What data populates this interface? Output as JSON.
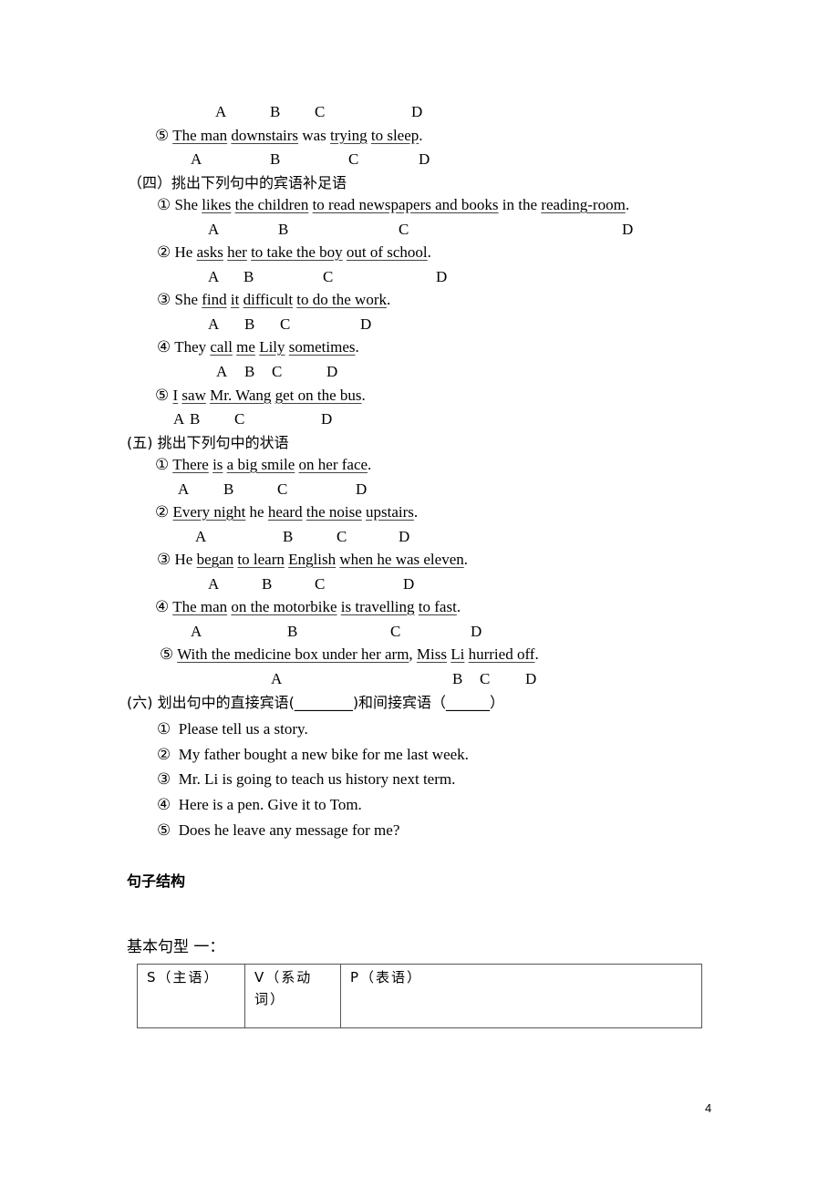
{
  "top_labels": [
    "A",
    "B",
    "C",
    "D"
  ],
  "section3_item5": {
    "num": "⑤",
    "parts": [
      {
        "text": "The man",
        "u": true
      },
      {
        "text": " ",
        "u": false
      },
      {
        "text": "downstairs",
        "u": true
      },
      {
        "text": " was ",
        "u": false
      },
      {
        "text": "trying",
        "u": true
      },
      {
        "text": " ",
        "u": false
      },
      {
        "text": "to sleep",
        "u": true
      },
      {
        "text": ".",
        "u": false
      }
    ],
    "labels": [
      "A",
      "B",
      "C",
      "D"
    ]
  },
  "section4": {
    "title": "（四）挑出下列句中的宾语补足语",
    "items": [
      {
        "num": "①",
        "parts": [
          {
            "text": "She ",
            "u": false
          },
          {
            "text": "likes",
            "u": true
          },
          {
            "text": " ",
            "u": false
          },
          {
            "text": "the children",
            "u": true
          },
          {
            "text": " ",
            "u": false
          },
          {
            "text": "to read newspapers and books",
            "u": true
          },
          {
            "text": " in the ",
            "u": false
          },
          {
            "text": "reading-room",
            "u": true
          },
          {
            "text": ".",
            "u": false
          }
        ],
        "labels": [
          "A",
          "B",
          "C",
          "D"
        ]
      },
      {
        "num": "②",
        "parts": [
          {
            "text": "He ",
            "u": false
          },
          {
            "text": "asks",
            "u": true
          },
          {
            "text": " ",
            "u": false
          },
          {
            "text": "her",
            "u": true
          },
          {
            "text": " ",
            "u": false
          },
          {
            "text": "to take the boy",
            "u": true
          },
          {
            "text": " ",
            "u": false
          },
          {
            "text": "out of school",
            "u": true
          },
          {
            "text": ".",
            "u": false
          }
        ],
        "labels": [
          "A",
          "B",
          "C",
          "D"
        ]
      },
      {
        "num": "③",
        "parts": [
          {
            "text": "She ",
            "u": false
          },
          {
            "text": "find",
            "u": true
          },
          {
            "text": " ",
            "u": false
          },
          {
            "text": "it",
            "u": true
          },
          {
            "text": " ",
            "u": false
          },
          {
            "text": "difficult",
            "u": true
          },
          {
            "text": " ",
            "u": false
          },
          {
            "text": "to do the work",
            "u": true
          },
          {
            "text": ".",
            "u": false
          }
        ],
        "labels": [
          "A",
          "B",
          "C",
          "D"
        ]
      },
      {
        "num": "④",
        "parts": [
          {
            "text": "They ",
            "u": false
          },
          {
            "text": "call",
            "u": true
          },
          {
            "text": " ",
            "u": false
          },
          {
            "text": "me",
            "u": true
          },
          {
            "text": " ",
            "u": false
          },
          {
            "text": "Lily",
            "u": true
          },
          {
            "text": " ",
            "u": false
          },
          {
            "text": "sometimes",
            "u": true
          },
          {
            "text": ".",
            "u": false
          }
        ],
        "labels": [
          "A",
          "B",
          "C",
          "D"
        ]
      },
      {
        "num": "⑤",
        "parts": [
          {
            "text": "I",
            "u": true
          },
          {
            "text": " ",
            "u": false
          },
          {
            "text": "saw",
            "u": true
          },
          {
            "text": " ",
            "u": false
          },
          {
            "text": "Mr. Wang",
            "u": true
          },
          {
            "text": " ",
            "u": false
          },
          {
            "text": "get on the bus",
            "u": true
          },
          {
            "text": ".",
            "u": false
          }
        ],
        "labels": [
          "A",
          "B",
          "C",
          "D"
        ]
      }
    ]
  },
  "section5": {
    "title": "(五)  挑出下列句中的状语",
    "items": [
      {
        "num": "①",
        "parts": [
          {
            "text": "There",
            "u": true
          },
          {
            "text": " ",
            "u": false
          },
          {
            "text": "is",
            "u": true
          },
          {
            "text": " ",
            "u": false
          },
          {
            "text": "a big smile",
            "u": true
          },
          {
            "text": " ",
            "u": false
          },
          {
            "text": "on her face",
            "u": true
          },
          {
            "text": ".",
            "u": false
          }
        ],
        "labels": [
          "A",
          "B",
          "C",
          "D"
        ]
      },
      {
        "num": "②",
        "parts": [
          {
            "text": "Every night",
            "u": true
          },
          {
            "text": " he ",
            "u": false
          },
          {
            "text": "heard",
            "u": true
          },
          {
            "text": " ",
            "u": false
          },
          {
            "text": "the noise",
            "u": true
          },
          {
            "text": " ",
            "u": false
          },
          {
            "text": "upstairs",
            "u": true
          },
          {
            "text": ".",
            "u": false
          }
        ],
        "labels": [
          "A",
          "B",
          "C",
          "D"
        ]
      },
      {
        "num": "③",
        "parts": [
          {
            "text": "He ",
            "u": false
          },
          {
            "text": "began",
            "u": true
          },
          {
            "text": " ",
            "u": false
          },
          {
            "text": "to learn",
            "u": true
          },
          {
            "text": " ",
            "u": false
          },
          {
            "text": "English",
            "u": true
          },
          {
            "text": " ",
            "u": false
          },
          {
            "text": "when he was eleven",
            "u": true
          },
          {
            "text": ".",
            "u": false
          }
        ],
        "labels": [
          "A",
          "B",
          "C",
          "D"
        ]
      },
      {
        "num": "④",
        "parts": [
          {
            "text": "The man",
            "u": true
          },
          {
            "text": " ",
            "u": false
          },
          {
            "text": "on the motorbike",
            "u": true
          },
          {
            "text": " ",
            "u": false
          },
          {
            "text": "is travelling",
            "u": true
          },
          {
            "text": " ",
            "u": false
          },
          {
            "text": "to fast",
            "u": true
          },
          {
            "text": ".",
            "u": false
          }
        ],
        "labels": [
          "A",
          "B",
          "C",
          "D"
        ]
      },
      {
        "num": "⑤",
        "parts": [
          {
            "text": "With the medicine box under her arm",
            "u": true
          },
          {
            "text": ", ",
            "u": false
          },
          {
            "text": "Miss",
            "u": true
          },
          {
            "text": " ",
            "u": false
          },
          {
            "text": "Li",
            "u": true
          },
          {
            "text": " ",
            "u": false
          },
          {
            "text": "hurried off",
            "u": true
          },
          {
            "text": ".",
            "u": false
          }
        ],
        "labels": [
          "A",
          "B",
          "C",
          "D"
        ]
      }
    ]
  },
  "section6": {
    "title": "(六)  划出句中的直接宾语(________)和间接宾语（______）",
    "items": [
      {
        "num": "①",
        "text": "Please tell us a story."
      },
      {
        "num": "②",
        "text": "My father bought a new bike for me last week."
      },
      {
        "num": "③",
        "text": "Mr. Li is going to teach us history next term."
      },
      {
        "num": "④",
        "text": "Here is a pen. Give it to Tom."
      },
      {
        "num": "⑤",
        "text": "Does he leave any message for me?"
      }
    ]
  },
  "structure_heading": "句子结构",
  "pattern_heading": "基本句型 一：",
  "pattern_table": {
    "cells": [
      "S（主语）",
      "V（系动词）",
      "P（表语）"
    ]
  },
  "page_number": "4"
}
